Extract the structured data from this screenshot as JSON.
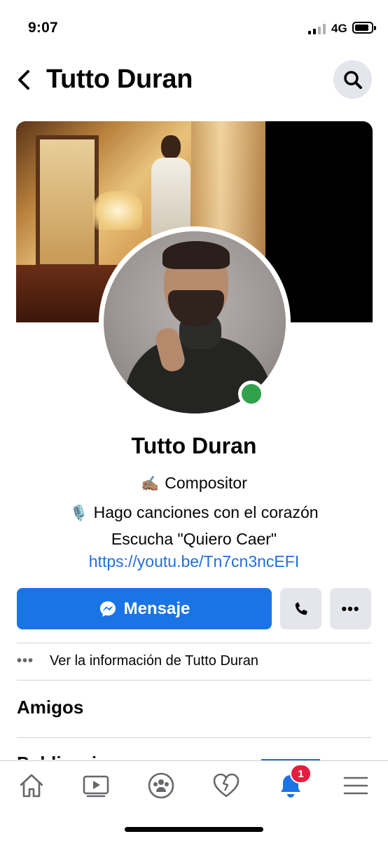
{
  "status_bar": {
    "time": "9:07",
    "network": "4G",
    "icons": [
      "signal-icon",
      "battery-icon"
    ]
  },
  "header": {
    "title": "Tutto Duran",
    "back_icon": "chevron-left-icon",
    "search_icon": "search-icon"
  },
  "profile": {
    "name": "Tutto Duran",
    "online": true,
    "bio": {
      "line1_emoji": "✍🏽",
      "line1_text": "Compositor",
      "line2_emoji": "🎙️",
      "line2_text": "Hago canciones con el corazón",
      "line3_text": "Escucha \"Quiero Caer\"",
      "link": "https://youtu.be/Tn7cn3ncEFI"
    }
  },
  "actions": {
    "message_label": "Mensaje",
    "message_icon": "messenger-icon",
    "call_icon": "phone-icon",
    "more_label": "•••"
  },
  "info_row": {
    "dots": "•••",
    "label": "Ver la información de Tutto Duran"
  },
  "sections": {
    "friends_title": "Amigos",
    "next_title": "Publicaciones"
  },
  "bottom_nav": {
    "items": [
      "home-icon",
      "watch-icon",
      "groups-icon",
      "dating-icon",
      "notifications-icon",
      "menu-icon"
    ],
    "active": "notifications-icon",
    "notification_badge": "1"
  },
  "colors": {
    "accent": "#1b74e4",
    "link": "#216fdb",
    "online": "#31a24c",
    "badge": "#e41e3f",
    "button_gray": "#e4e6eb"
  }
}
